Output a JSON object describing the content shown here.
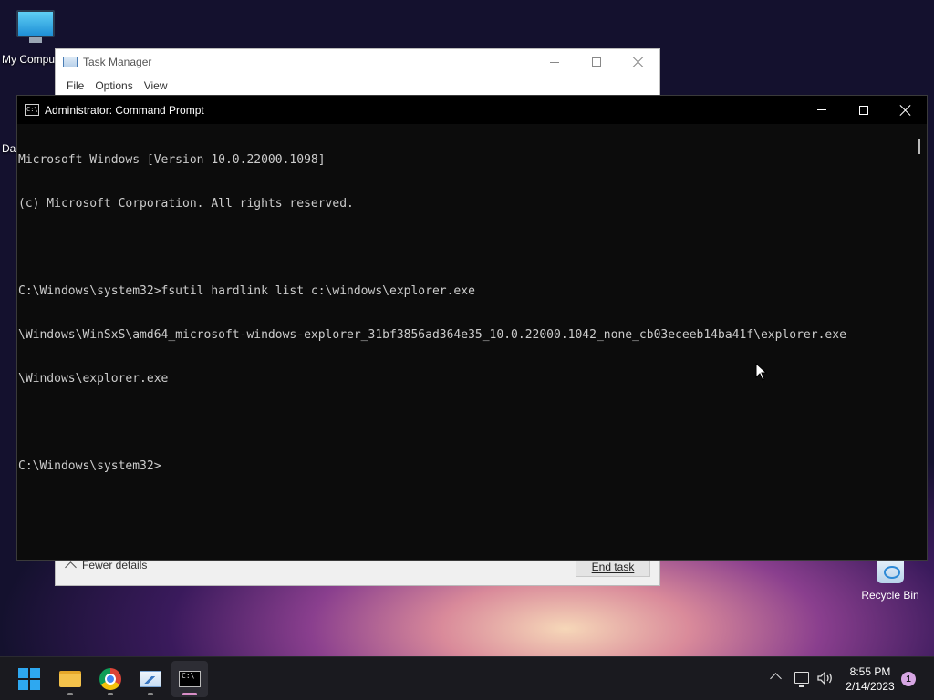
{
  "desktop": {
    "icons": [
      {
        "label": "My Compu"
      },
      {
        "label": "Da"
      },
      {
        "label": "Recycle Bin"
      }
    ]
  },
  "task_manager": {
    "title": "Task Manager",
    "menu": [
      "File",
      "Options",
      "View"
    ],
    "fewer_details": "Fewer details",
    "end_task": "End task"
  },
  "cmd": {
    "title": "Administrator: Command Prompt",
    "lines": [
      "Microsoft Windows [Version 10.0.22000.1098]",
      "(c) Microsoft Corporation. All rights reserved.",
      "",
      "C:\\Windows\\system32>fsutil hardlink list c:\\windows\\explorer.exe",
      "\\Windows\\WinSxS\\amd64_microsoft-windows-explorer_31bf3856ad364e35_10.0.22000.1042_none_cb03eceeb14ba41f\\explorer.exe",
      "\\Windows\\explorer.exe",
      "",
      "C:\\Windows\\system32>"
    ]
  },
  "taskbar": {
    "apps": [
      {
        "name": "start",
        "icon": "windows-logo-icon"
      },
      {
        "name": "file-explorer",
        "icon": "folder-icon"
      },
      {
        "name": "chrome",
        "icon": "chrome-icon"
      },
      {
        "name": "task-manager",
        "icon": "task-manager-icon"
      },
      {
        "name": "command-prompt",
        "icon": "cmd-icon",
        "active": true
      }
    ],
    "time": "8:55 PM",
    "date": "2/14/2023",
    "notification_count": "1"
  },
  "colors": {
    "accent": "#2ea8f0",
    "console_bg": "#0c0c0c",
    "console_fg": "#cccccc",
    "active_indicator": "#d98ec7"
  }
}
